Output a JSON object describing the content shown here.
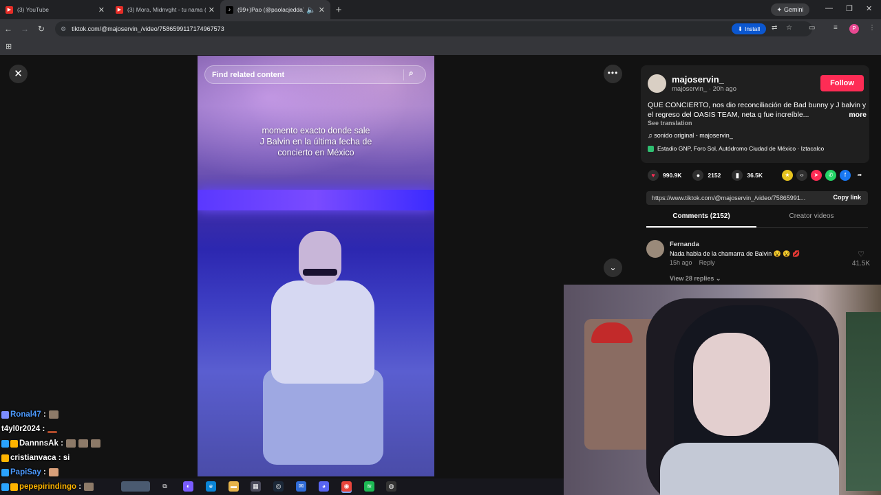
{
  "browser": {
    "tabs": [
      {
        "title": "(3) YouTube",
        "icon": "youtube-icon"
      },
      {
        "title": "(3) Mora, Midnvght - tu nama (",
        "icon": "youtube-icon"
      },
      {
        "title": "(99+)Pao (@paolacjedda) |",
        "icon": "tiktok-icon"
      }
    ],
    "gemini_label": "Gemini",
    "url": "tiktok.com/@majoservin_/video/7586599117174967573",
    "install_label": "Install",
    "profile_initial": "P"
  },
  "video": {
    "search_placeholder": "Find related content",
    "caption_lines": [
      "momento exacto donde sale",
      "J Balvin en la última fecha de",
      "concierto en México"
    ]
  },
  "post": {
    "username": "majoservin_",
    "subline": "majoservin_ · 20h ago",
    "follow_label": "Follow",
    "description": "QUE CONCIERTO, nos dio reconciliación de Bad bunny y J balvin y el regreso del OASIS TEAM, neta q fue increíble...",
    "more_label": "more",
    "see_translation": "See translation",
    "music": "sonido original - majoservin_",
    "location": "Estadio GNP, Foro Sol, Autódromo Ciudad de México · Iztacalco",
    "likes": "990.9K",
    "comments": "2152",
    "saves": "36.5K",
    "link": "https://www.tiktok.com/@majoservin_/video/75865991...",
    "copy_link": "Copy link"
  },
  "tabs": {
    "comments_label": "Comments (2152)",
    "creator_label": "Creator videos"
  },
  "comment": {
    "name": "Fernanda",
    "text": "Nada habla de la chamarra de Balvin 😵 😵 💋",
    "time": "15h ago",
    "reply": "Reply",
    "likes": "41.5K",
    "view_replies": "View 28 replies"
  },
  "chat": [
    {
      "user": "Ronal47",
      "message": "",
      "user_color": "#4d9bff"
    },
    {
      "user": "t4yl0r2024",
      "message": "",
      "user_color": "#ffffff"
    },
    {
      "user": "DannnsAk",
      "message": "",
      "user_color": "#ffffff"
    },
    {
      "user": "cristianvaca",
      "message": "si",
      "user_color": "#ffffff"
    },
    {
      "user": "PapiSay",
      "message": "",
      "user_color": "#4d9bff"
    },
    {
      "user": "pepepirindingo",
      "message": "",
      "user_color": "#ffb400"
    }
  ],
  "colors": {
    "follow": "#fe2c55",
    "accent_blue": "#0b57d0"
  }
}
